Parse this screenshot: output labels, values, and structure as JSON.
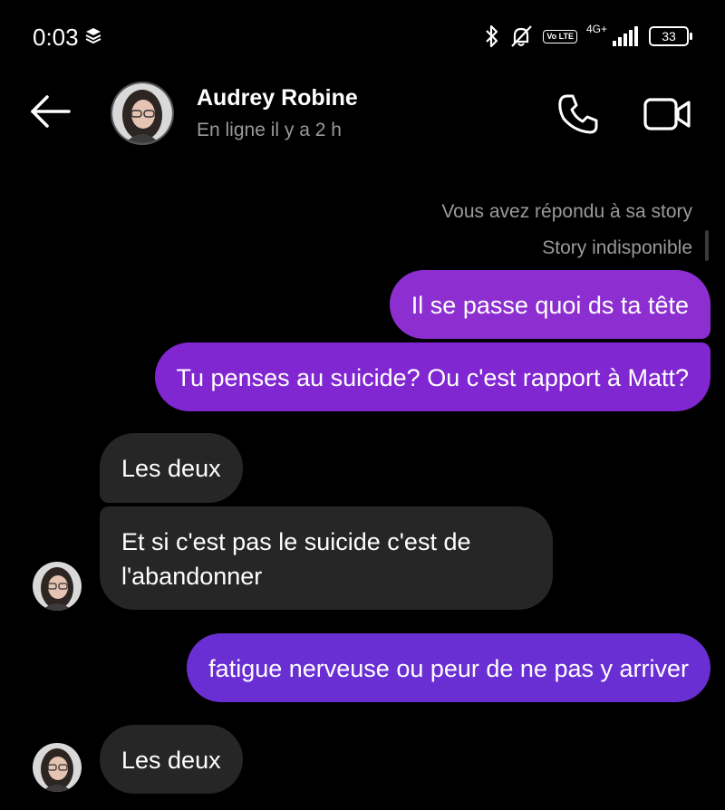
{
  "statusbar": {
    "time": "0:03",
    "volte": "Vo LTE",
    "network": "4G+",
    "battery": "33"
  },
  "header": {
    "name": "Audrey Robine",
    "status": "En ligne il y a 2 h"
  },
  "meta": {
    "replied": "Vous avez répondu à sa story",
    "unavailable": "Story indisponible"
  },
  "messages": [
    {
      "from": "me",
      "text": "Il se passe quoi ds ta tête"
    },
    {
      "from": "me",
      "text": "Tu penses au suicide? Ou c'est rapport à Matt?"
    },
    {
      "from": "them",
      "text": "Les deux"
    },
    {
      "from": "them",
      "text": "Et si c'est pas le suicide c'est de l'abandonner"
    },
    {
      "from": "me",
      "text": "fatigue nerveuse ou peur de ne pas y arriver"
    },
    {
      "from": "them",
      "text": "Les deux"
    }
  ],
  "colors": {
    "background": "#000000",
    "outgoing_bubble": "#8127d2",
    "outgoing_bubble_last": "#6a2fd3",
    "incoming_bubble": "#262626",
    "meta_text": "#9a9a9a"
  },
  "icons": [
    "layers-icon",
    "bluetooth-icon",
    "bell-off-icon",
    "signal-icon",
    "back-arrow-icon",
    "phone-icon",
    "video-icon"
  ]
}
